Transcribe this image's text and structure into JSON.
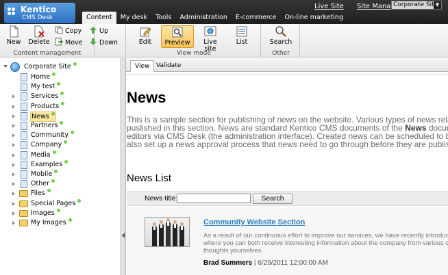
{
  "header": {
    "logo_name": "Kentico",
    "logo_sub": "CMS Desk",
    "links": [
      "Live Site",
      "Site Manager"
    ],
    "site_selector": "Corporate Site",
    "tabs": [
      "Content",
      "My desk",
      "Tools",
      "Administration",
      "E-commerce",
      "On-line marketing"
    ],
    "active_tab": "Content"
  },
  "ribbon": {
    "content_management": {
      "label": "Content management",
      "new": "New",
      "delete": "Delete",
      "copy": "Copy",
      "move": "Move",
      "up": "Up",
      "down": "Down"
    },
    "view_mode": {
      "label": "View mode",
      "edit": "Edit",
      "preview": "Preview",
      "live_site": "Live site",
      "list": "List",
      "active": "Preview"
    },
    "other": {
      "label": "Other",
      "search": "Search"
    }
  },
  "tree": {
    "root": "Corporate Site",
    "items": [
      {
        "label": "Home",
        "type": "doc",
        "expandable": false
      },
      {
        "label": "My test",
        "type": "doc",
        "expandable": false
      },
      {
        "label": "Services",
        "type": "doc",
        "expandable": true
      },
      {
        "label": "Products",
        "type": "doc",
        "expandable": true
      },
      {
        "label": "News",
        "type": "doc",
        "expandable": true,
        "selected": true
      },
      {
        "label": "Partners",
        "type": "doc",
        "expandable": true
      },
      {
        "label": "Community",
        "type": "doc",
        "expandable": true
      },
      {
        "label": "Company",
        "type": "doc",
        "expandable": true
      },
      {
        "label": "Media",
        "type": "doc",
        "expandable": true
      },
      {
        "label": "Examples",
        "type": "doc",
        "expandable": true
      },
      {
        "label": "Mobile",
        "type": "doc",
        "expandable": true
      },
      {
        "label": "Other",
        "type": "doc",
        "expandable": true
      },
      {
        "label": "Files",
        "type": "folder",
        "expandable": true
      },
      {
        "label": "Special Pages",
        "type": "folder",
        "expandable": true
      },
      {
        "label": "Images",
        "type": "folder",
        "expandable": true
      },
      {
        "label": "My Images",
        "type": "folder",
        "expandable": true
      }
    ]
  },
  "content_tabs": [
    "View",
    "Validate"
  ],
  "page": {
    "title": "News",
    "intro_1": "This is a sample section for publishing of news on the website. Various types of news related to the to",
    "intro_2": "puslished in this section. News are standard Kentico CMS documents of the ",
    "intro_2_bold": "News",
    "intro_2_end": " document type. Th",
    "intro_3": "editors via CMS Desk (the administration interface). Created news can be scheduled to be published",
    "intro_4": "also set up a news approval process that news need to go through before they are published.",
    "list_title": "News List",
    "filter_label": "News title:",
    "filter_value": "",
    "filter_button": "Search",
    "news": {
      "title": "Community Website Section",
      "summary_1": "As a result of our continuous effort to improve our services, we have recently introduced t",
      "summary_2": "where you can both receive interesting information about the company from various comm",
      "summary_3": "thoughts yourselves.",
      "author": "Brad Summers",
      "date": "6/29/2011 12:00:00 AM"
    }
  }
}
